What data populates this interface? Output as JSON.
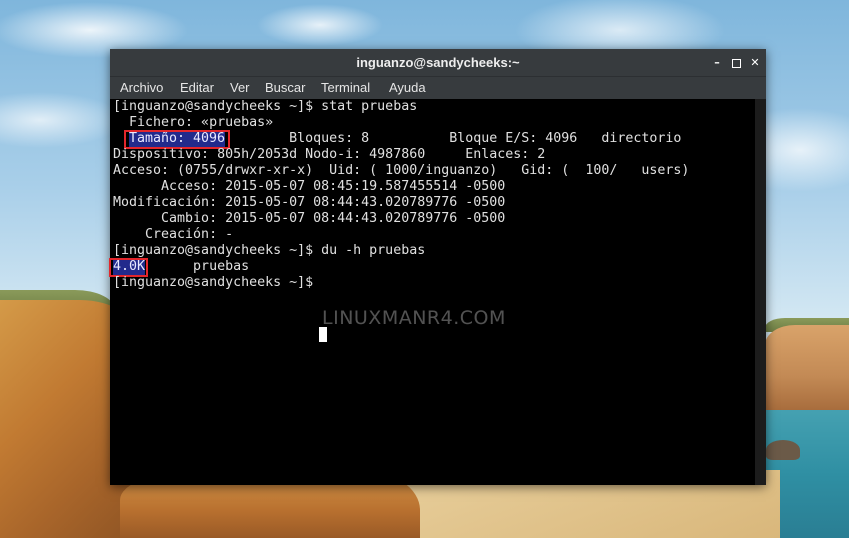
{
  "window": {
    "title": "inguanzo@sandycheeks:~",
    "controls": {
      "minimize": "–",
      "close": "✕"
    }
  },
  "menu": [
    "Archivo",
    "Editar",
    "Ver",
    "Buscar",
    "Terminal",
    "Ayuda"
  ],
  "terminal": {
    "lines": [
      "[inguanzo@sandycheeks ~]$ stat pruebas",
      "  Fichero: «pruebas»",
      "                      Bloques: 8          Bloque E/S: 4096   directorio",
      "Dispositivo: 805h/2053d Nodo-i: 4987860     Enlaces: 2",
      "Acceso: (0755/drwxr-xr-x)  Uid: ( 1000/inguanzo)   Gid: (  100/   users)",
      "      Acceso: 2015-05-07 08:45:19.587455514 -0500",
      "Modificación: 2015-05-07 08:44:43.020789776 -0500",
      "      Cambio: 2015-05-07 08:44:43.020789776 -0500",
      "    Creación: -",
      "[inguanzo@sandycheeks ~]$ du -h pruebas",
      "          pruebas",
      "[inguanzo@sandycheeks ~]$ "
    ],
    "size_highlight": "Tamaño: 4096",
    "du_highlight": "4.0K"
  },
  "watermark": "LINUXMANR4.COM"
}
